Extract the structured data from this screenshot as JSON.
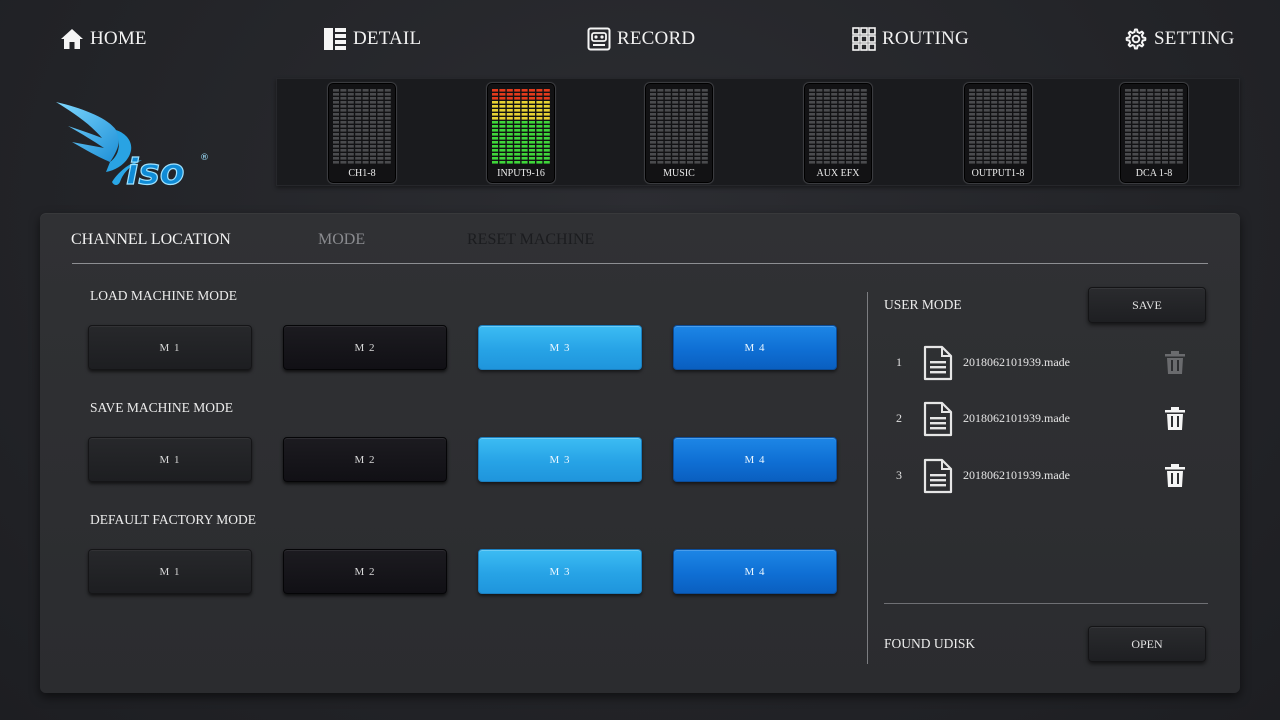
{
  "nav": {
    "home": "HOME",
    "detail": "DETAIL",
    "record": "RECORD",
    "routing": "ROUTING",
    "setting": "SETTING",
    "icons": [
      "home-icon",
      "detail-icon",
      "record-icon",
      "routing-icon",
      "gear-icon"
    ]
  },
  "logo": {
    "text": "iso",
    "mark": "®"
  },
  "meters": [
    {
      "label": "CH1-8",
      "active": false
    },
    {
      "label": "INPUT9-16",
      "active": true
    },
    {
      "label": "MUSIC",
      "active": false
    },
    {
      "label": "AUX EFX",
      "active": false
    },
    {
      "label": "OUTPUT1-8",
      "active": false
    },
    {
      "label": "DCA 1-8",
      "active": false
    }
  ],
  "tabs": {
    "channel_location": "CHANNEL LOCATION",
    "mode": "MODE",
    "reset_machine": "RESET MACHINE"
  },
  "sections": {
    "load": "LOAD MACHINE MODE",
    "save": "SAVE MACHINE MODE",
    "default": "DEFAULT FACTORY MODE"
  },
  "mode_buttons": [
    "M 1",
    "M 2",
    "M 3",
    "M 4"
  ],
  "user_mode": {
    "title": "USER MODE",
    "save_label": "SAVE",
    "files": [
      {
        "index": "1",
        "name": "2018062101939.made",
        "trash_enabled": false
      },
      {
        "index": "2",
        "name": "2018062101939.made",
        "trash_enabled": true
      },
      {
        "index": "3",
        "name": "2018062101939.made",
        "trash_enabled": true
      }
    ]
  },
  "udisk": {
    "title": "FOUND UDISK",
    "open_label": "OPEN"
  },
  "colors": {
    "accent_light_blue": "#27a3e6",
    "accent_blue": "#0f6fd4",
    "background": "#232428",
    "meter_green": "#3fd63a",
    "meter_yellow": "#e6d233",
    "meter_red": "#e33a1c"
  }
}
